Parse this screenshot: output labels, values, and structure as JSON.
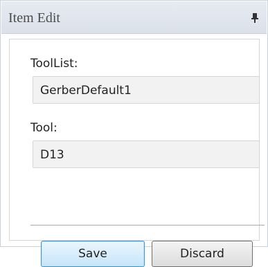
{
  "window": {
    "title": "Item Edit",
    "pin_icon": "pin-icon"
  },
  "form": {
    "toollist_label": "ToolList:",
    "toollist_value": "GerberDefault1",
    "tool_label": "Tool:",
    "tool_value": "D13"
  },
  "actions": {
    "save_label": "Save",
    "discard_label": "Discard"
  },
  "colors": {
    "titlebar": "#dfe5ee",
    "save_border": "#3b94d9"
  }
}
